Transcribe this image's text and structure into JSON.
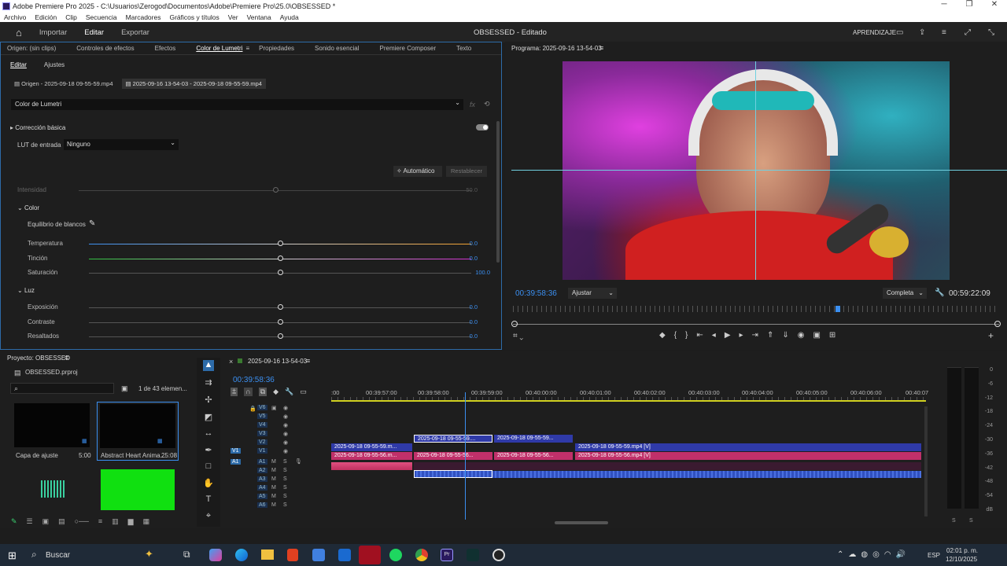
{
  "window": {
    "title": "Adobe Premiere Pro 2025 - C:\\Usuarios\\Zerogod\\Documentos\\Adobe\\Premiere Pro\\25.0\\OBSESSED *"
  },
  "menu": [
    "Archivo",
    "Edición",
    "Clip",
    "Secuencia",
    "Marcadores",
    "Gráficos y títulos",
    "Ver",
    "Ventana",
    "Ayuda"
  ],
  "appbar": {
    "workspaces": [
      "Importar",
      "Editar",
      "Exportar"
    ],
    "active": "Editar",
    "project_status": "OBSESSED - Editado",
    "learn": "APRENDIZAJE"
  },
  "left_panel": {
    "tabs": [
      "Origen: (sin clips)",
      "Controles de efectos",
      "Efectos",
      "Color de Lumetri",
      "Propiedades",
      "Sonido esencial",
      "Premiere Composer",
      "Texto"
    ],
    "active_tab": "Color de Lumetri",
    "subtabs": [
      "Editar",
      "Ajustes"
    ],
    "clip_tabs": [
      "Origen - 2025-09-18 09-55-59.mp4",
      "2025-09-16 13-54-03 - 2025-09-18 09-55-59.mp4"
    ],
    "effect_select": "Color de Lumetri",
    "section_basic": "Corrección básica",
    "lut_label": "LUT de entrada",
    "lut_value": "Ninguno",
    "auto_btn": "Automático",
    "reset_btn": "Restablecer",
    "intensity_label": "Intensidad",
    "intensity_value": "50.0",
    "color_section": "Color",
    "white_balance": "Equilibrio de blancos",
    "temperature": {
      "label": "Temperatura",
      "value": "0.0"
    },
    "tint": {
      "label": "Tinción",
      "value": "0.0"
    },
    "saturation": {
      "label": "Saturación",
      "value": "100.0"
    },
    "light_section": "Luz",
    "exposure": {
      "label": "Exposición",
      "value": "0.0"
    },
    "contrast": {
      "label": "Contraste",
      "value": "0.0"
    },
    "highlights": {
      "label": "Resaltados",
      "value": "0.0"
    }
  },
  "program": {
    "title": "Programa: 2025-09-16 13-54-03",
    "timecode": "00:39:58:36",
    "fit": "Ajustar",
    "quality": "Completa",
    "duration": "00:59:22:09"
  },
  "project": {
    "title": "Proyecto: OBSESSED",
    "file": "OBSESSED.prproj",
    "count": "1 de 43 elemen...",
    "items": [
      {
        "name": "Capa de ajuste",
        "duration": "5:00"
      },
      {
        "name": "Abstract Heart Anima...",
        "duration": "25:08"
      }
    ]
  },
  "timeline": {
    "sequence": "2025-09-16 13-54-03",
    "timecode": "00:39:58:36",
    "ruler": [
      ":00",
      "00:39:57:00",
      "00:39:58:00",
      "00:39:59:00",
      "00:40:00:00",
      "00:40:01:00",
      "00:40:02:00",
      "00:40:03:00",
      "00:40:04:00",
      "00:40:05:00",
      "00:40:06:00",
      "00:40:07"
    ],
    "video_tracks": [
      "V6",
      "V5",
      "V4",
      "V3",
      "V2",
      "V1"
    ],
    "audio_tracks": [
      "A1",
      "A2",
      "A3",
      "A4",
      "A5",
      "A6"
    ],
    "clips": {
      "v3a": "2025-09-18 09-55-59....",
      "v3b": "2025-09-18 09-55-59...",
      "v2a": "2025-09-18 09-55-59.m...",
      "v2b": "2025-09-18 09-55-59.mp4 [V]",
      "v1a": "2025-09-18 09-55-56.m...",
      "v1b": "2025-09-18 09-55-56...",
      "v1c": "2025-09-18 09-55-56...",
      "v1d": "2025-09-18 09-55-56.mp4 [V]"
    }
  },
  "meters": {
    "scale": [
      "0",
      "-6",
      "-12",
      "-18",
      "-24",
      "-30",
      "-36",
      "-42",
      "-48",
      "-54",
      "dB"
    ],
    "bottom": [
      "S",
      "S"
    ]
  },
  "taskbar": {
    "search": "Buscar",
    "lang": "ESP",
    "time": "02:01 p. m.",
    "date": "12/10/2025"
  }
}
